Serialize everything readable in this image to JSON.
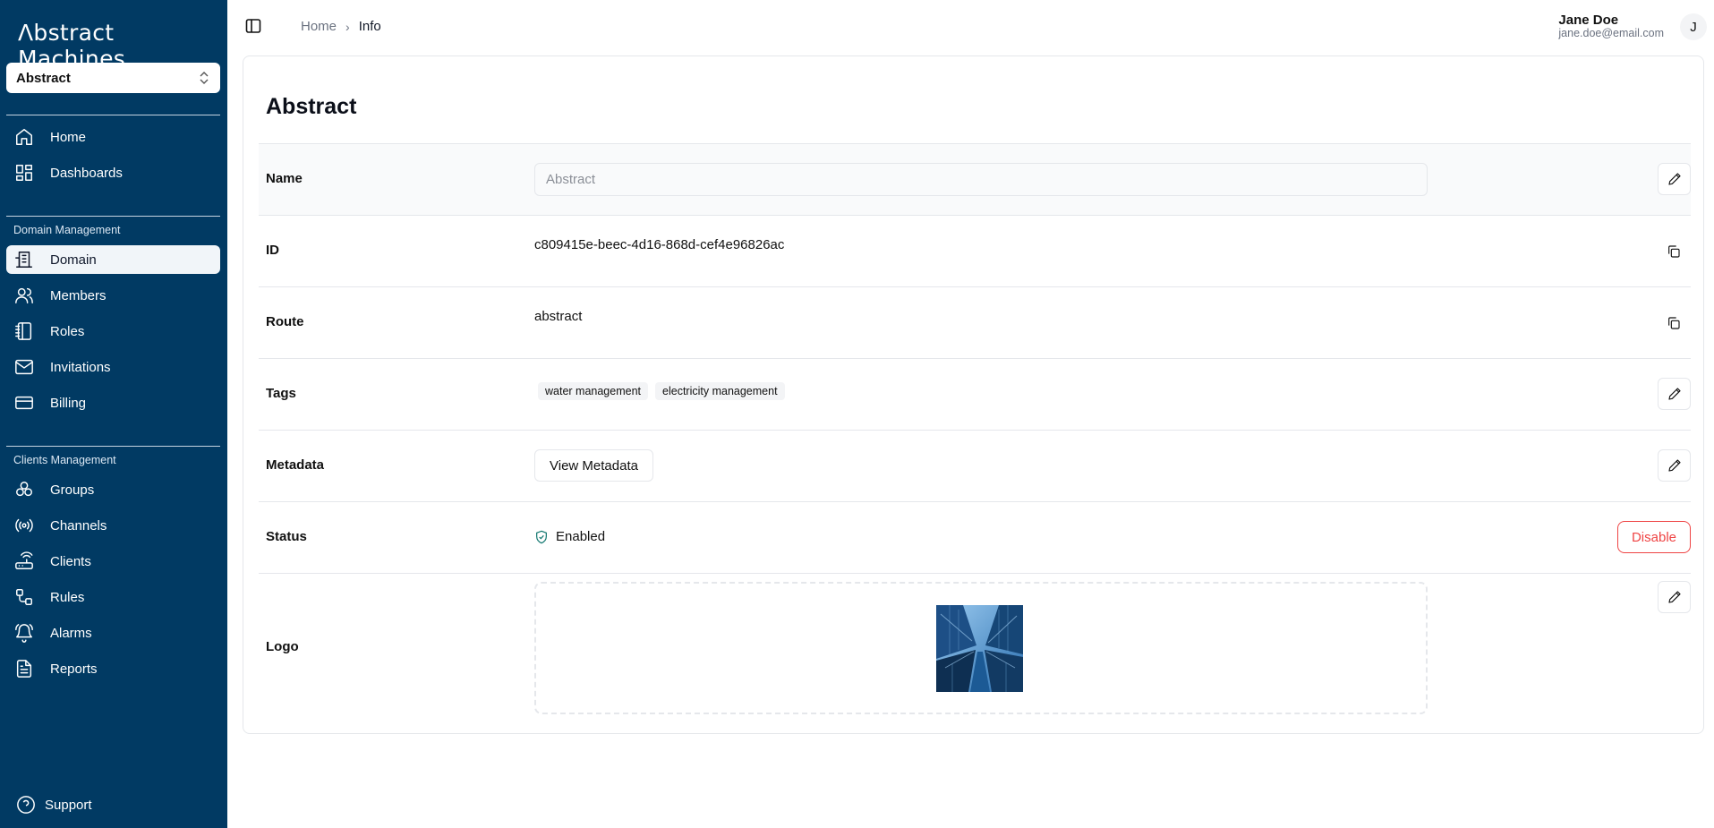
{
  "app": {
    "logo_text": "Λbstract Ⅿachines",
    "domain_select": "Abstract",
    "support_label": "Support"
  },
  "sidebar": {
    "main_items": [
      {
        "label": "Home",
        "icon": "home-icon"
      },
      {
        "label": "Dashboards",
        "icon": "dashboard-icon"
      }
    ],
    "domain_section_label": "Domain Management",
    "domain_items": [
      {
        "label": "Domain",
        "icon": "building-icon",
        "active": true
      },
      {
        "label": "Members",
        "icon": "users-icon"
      },
      {
        "label": "Roles",
        "icon": "notebook-icon"
      },
      {
        "label": "Invitations",
        "icon": "mail-icon"
      },
      {
        "label": "Billing",
        "icon": "credit-card-icon"
      }
    ],
    "clients_section_label": "Clients Management",
    "clients_items": [
      {
        "label": "Groups",
        "icon": "groups-icon"
      },
      {
        "label": "Channels",
        "icon": "radio-icon"
      },
      {
        "label": "Clients",
        "icon": "router-icon"
      },
      {
        "label": "Rules",
        "icon": "workflow-icon"
      },
      {
        "label": "Alarms",
        "icon": "bell-ring-icon"
      },
      {
        "label": "Reports",
        "icon": "file-text-icon"
      }
    ]
  },
  "topbar": {
    "breadcrumb": [
      "Home",
      "Info"
    ],
    "user_name": "Jane Doe",
    "user_email": "jane.doe@email.com",
    "avatar_initial": "J"
  },
  "card": {
    "title": "Abstract",
    "rows": {
      "name": {
        "label": "Name",
        "placeholder": "Abstract"
      },
      "id": {
        "label": "ID",
        "value": "c809415e-beec-4d16-868d-cef4e96826ac"
      },
      "route": {
        "label": "Route",
        "value": "abstract"
      },
      "tags": {
        "label": "Tags",
        "values": [
          "water management",
          "electricity management"
        ]
      },
      "metadata": {
        "label": "Metadata",
        "button": "View Metadata"
      },
      "status": {
        "label": "Status",
        "value": "Enabled",
        "action": "Disable"
      },
      "logo": {
        "label": "Logo"
      }
    }
  },
  "colors": {
    "sidebar_bg": "#013a63",
    "status_enabled": "#0f766e",
    "danger": "#ef4444"
  }
}
